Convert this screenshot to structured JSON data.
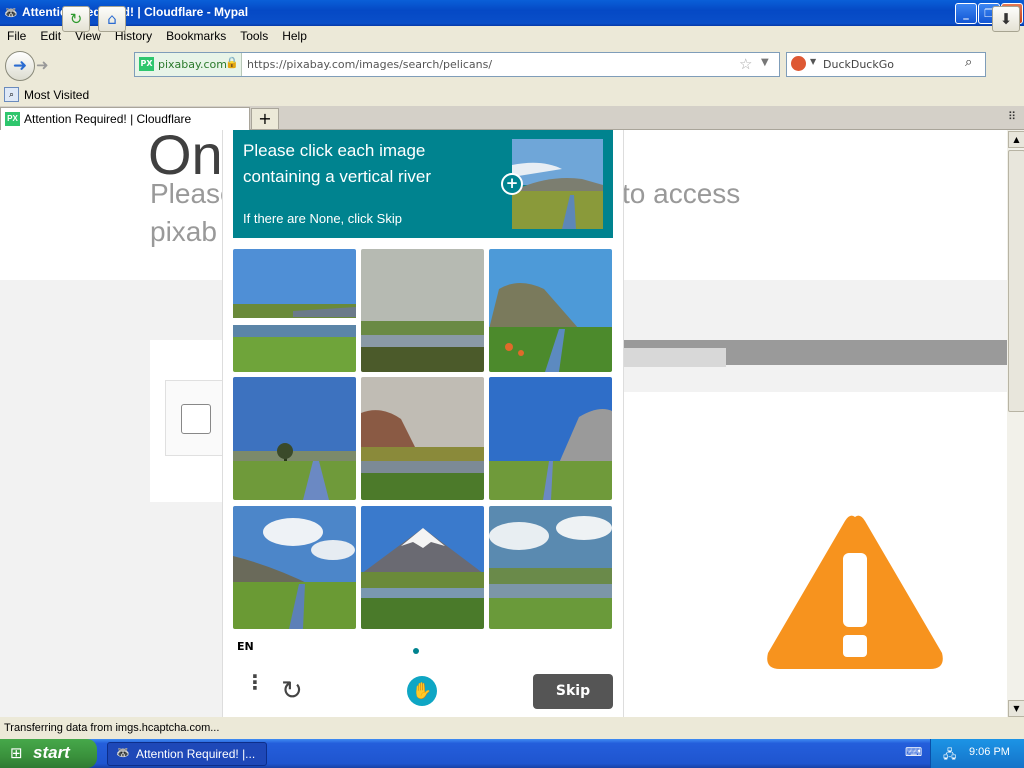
{
  "window": {
    "title": "Attention Required! | Cloudflare - Mypal"
  },
  "menu": {
    "items": [
      "File",
      "Edit",
      "View",
      "History",
      "Bookmarks",
      "Tools",
      "Help"
    ]
  },
  "nav": {
    "site_badge": "PX",
    "site_domain": "pixabay.com",
    "url": "https://pixabay.com/images/search/pelicans/",
    "search_engine": "DuckDuckGo"
  },
  "bookmarks": {
    "most_visited": "Most Visited"
  },
  "tabs": [
    {
      "label": "Attention Required! | Cloudflare",
      "badge": "PX"
    }
  ],
  "background_page": {
    "heading_fragment": "On",
    "line1_left": "Please",
    "line1_right": "to access",
    "line2_left": "pixab"
  },
  "captcha": {
    "prompt_line1": "Please click each image",
    "prompt_line2": "containing a vertical river",
    "prompt_skip_hint": "If there are None, click Skip",
    "language": "EN",
    "skip_label": "Skip",
    "teal": "#00838f"
  },
  "status": {
    "text": "Transferring data from imgs.hcaptcha.com..."
  },
  "taskbar": {
    "start_label": "start",
    "task_label": "Attention Required! |...",
    "time": "9:06 PM"
  },
  "colors": {
    "warning_orange": "#f7931e",
    "taskbar_blue": "#245edb"
  }
}
